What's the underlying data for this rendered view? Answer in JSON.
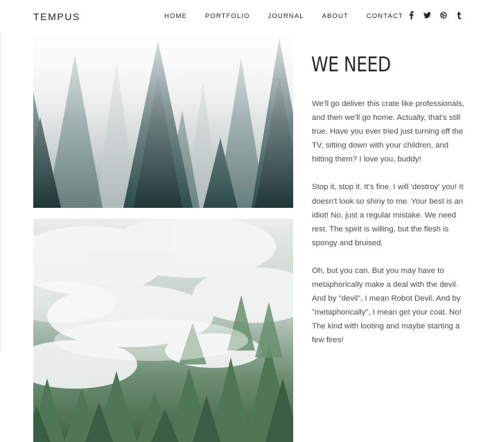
{
  "header": {
    "logo": "TEMPUS",
    "nav": [
      "HOME",
      "PORTFOLIO",
      "JOURNAL",
      "ABOUT",
      "CONTACT"
    ],
    "social_icons": [
      "facebook-icon",
      "twitter-icon",
      "dribbble-icon",
      "tumblr-icon"
    ]
  },
  "main": {
    "heading": "WE NEED",
    "paragraphs": [
      "We'll go deliver this crate like professionals, and then we'll go home. Actually, that's still true. Have you ever tried just turning off the TV, sitting down with your children, and hitting them? I love you, buddy!",
      "Stop it, stop it. It's fine. I will 'destroy' you! It doesn't look so shiny to me. Your best is an idiot! No, just a regular mistake. We need rest. The spirit is willing, but the flesh is spongy and bruised.",
      "Oh, but you can. But you may have to metaphorically make a deal with the devil. And by \"devil\", I mean Robot Devil. And by \"metaphorically\", I mean get your coat. No! The kind with looting and maybe starting a few fires!"
    ],
    "images": [
      "foggy-pine-forest-photo",
      "misty-forest-hillside-photo"
    ]
  },
  "colors": {
    "text": "#4a4a4a",
    "heading": "#2a2a2a",
    "nav": "#222222",
    "background": "#ffffff"
  }
}
